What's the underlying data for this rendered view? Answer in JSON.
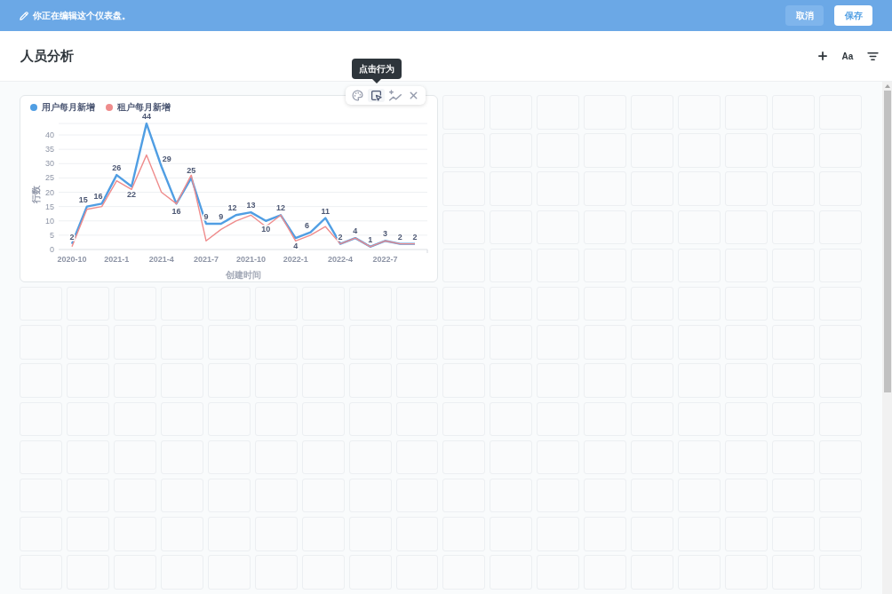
{
  "edit_bar": {
    "message": "你正在编辑这个仪表盘。",
    "buttons": [
      {
        "label": "取消",
        "kind": "cancel"
      },
      {
        "label": "保存",
        "kind": "save"
      }
    ]
  },
  "header": {
    "title": "人员分析",
    "tools": [
      {
        "kind": "add"
      },
      {
        "kind": "text",
        "label": "Aa"
      },
      {
        "kind": "filter"
      }
    ]
  },
  "dashboard": {
    "cards": [
      {
        "actions": [
          {
            "kind": "palette",
            "hovered": false
          },
          {
            "kind": "click_behavior",
            "hovered": true,
            "tooltip": "点击行为"
          },
          {
            "kind": "visualize",
            "hovered": false
          },
          {
            "kind": "remove",
            "hovered": false
          }
        ],
        "chart_data": {
          "type": "line",
          "legend": "top",
          "grid": true,
          "xlabel": "创建时间",
          "ylabel": "行数",
          "categories": [
            "2020-10",
            null,
            null,
            "2021-1",
            null,
            null,
            "2021-4",
            null,
            null,
            "2021-7",
            null,
            null,
            "2021-10",
            null,
            null,
            "2022-1",
            null,
            null,
            "2022-4",
            null,
            null,
            "2022-7",
            null,
            null
          ],
          "ylim": [
            0,
            44
          ],
          "yticks": [
            0,
            5,
            10,
            15,
            20,
            25,
            30,
            35,
            40
          ],
          "series": [
            {
              "name": "用户每月新增",
              "color": "#509ee3",
              "data_labels": true,
              "values": [
                2,
                15,
                16,
                26,
                22,
                44,
                29,
                16,
                25,
                9,
                9,
                12,
                13,
                10,
                12,
                4,
                6,
                11,
                2,
                4,
                1,
                3,
                2,
                2
              ]
            },
            {
              "name": "租户每月新增",
              "color": "#ef8c8c",
              "data_labels": false,
              "values": [
                1,
                14,
                15,
                24,
                21,
                33,
                20,
                16,
                26,
                3,
                7,
                10,
                12,
                8,
                12,
                3,
                5,
                8,
                2,
                4,
                1,
                3,
                2,
                2
              ]
            }
          ]
        }
      }
    ]
  }
}
